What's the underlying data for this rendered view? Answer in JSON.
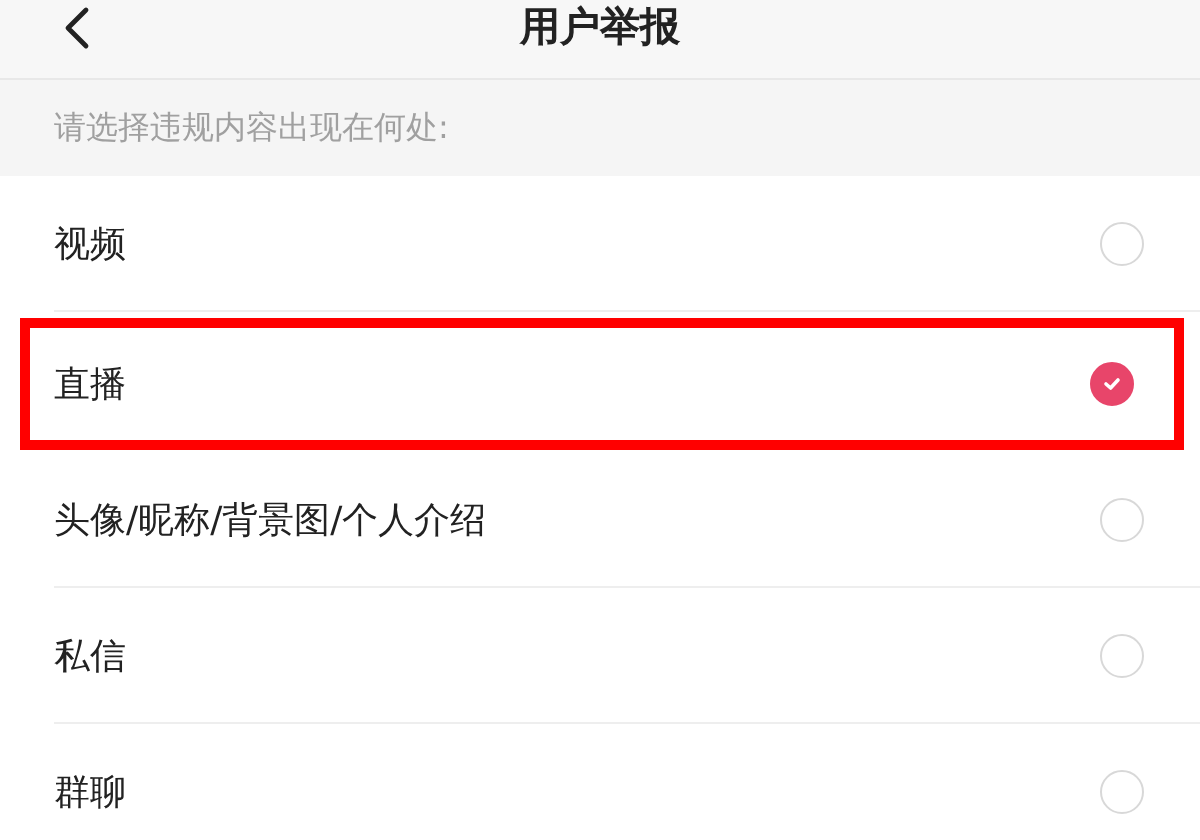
{
  "header": {
    "title": "用户举报"
  },
  "prompt": "请选择违规内容出现在何处:",
  "options": [
    {
      "label": "视频",
      "selected": false,
      "highlighted": false
    },
    {
      "label": "直播",
      "selected": true,
      "highlighted": true
    },
    {
      "label": "头像/昵称/背景图/个人介绍",
      "selected": false,
      "highlighted": false
    },
    {
      "label": "私信",
      "selected": false,
      "highlighted": false
    },
    {
      "label": "群聊",
      "selected": false,
      "highlighted": false
    }
  ]
}
